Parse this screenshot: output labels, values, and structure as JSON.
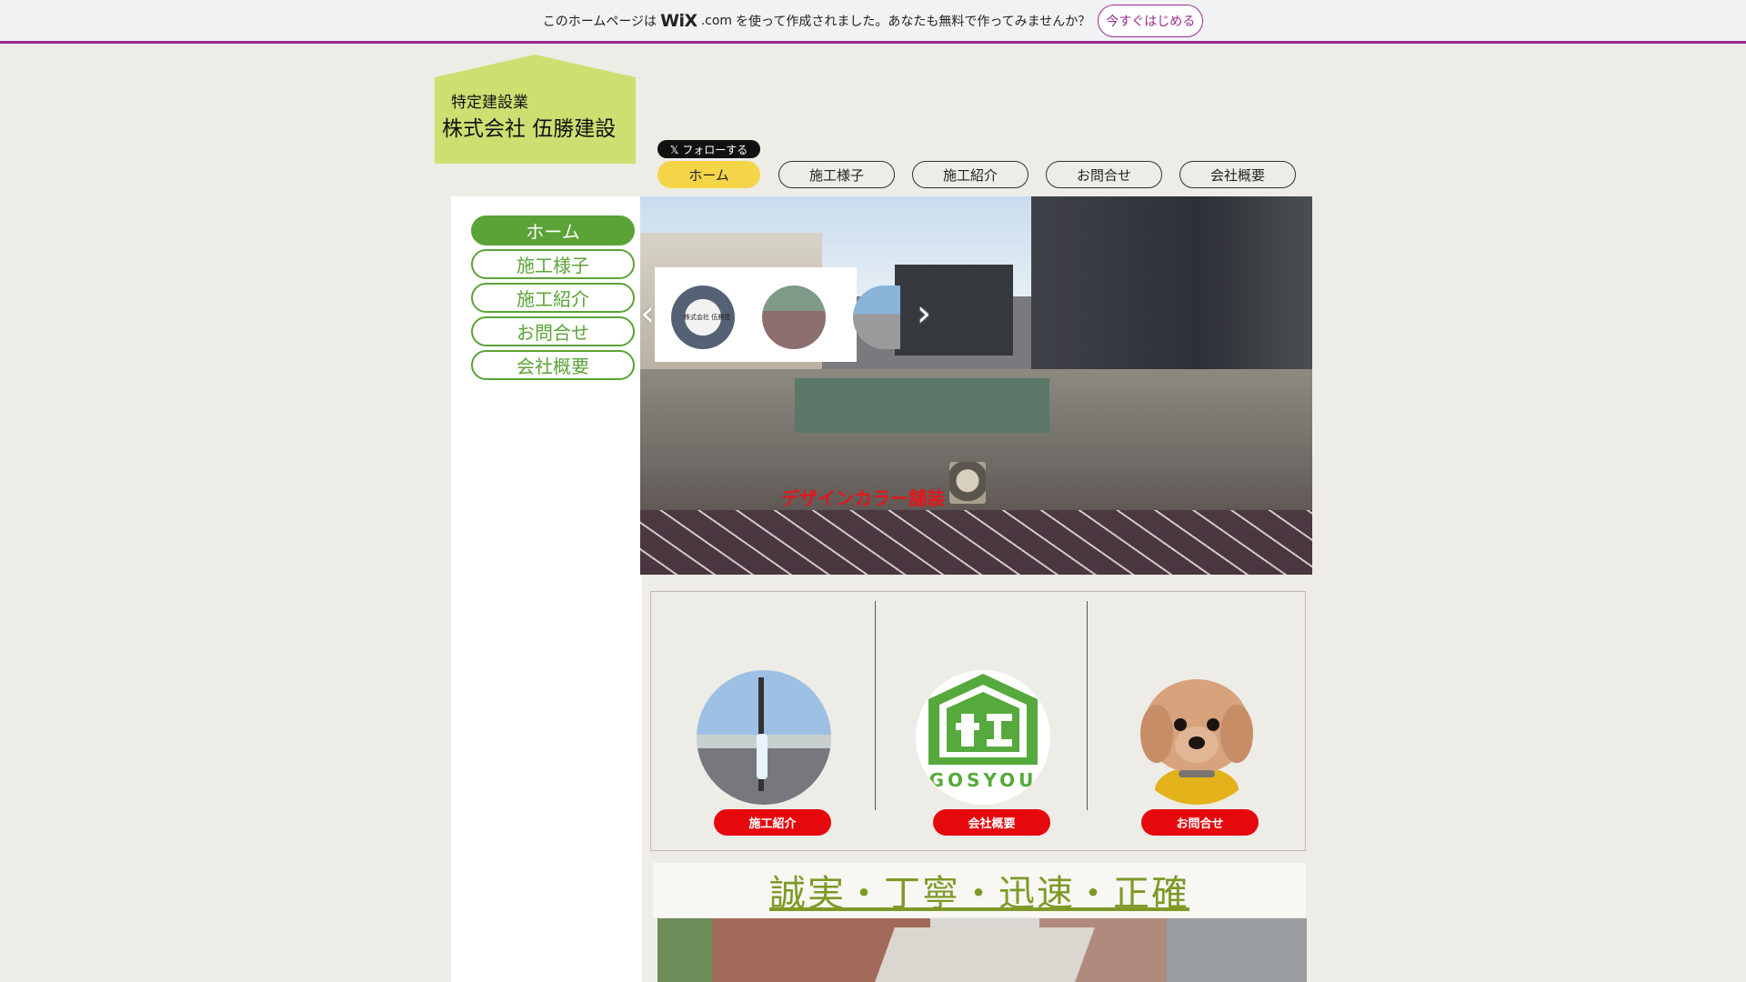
{
  "wix_banner": {
    "prefix": "このホームページは",
    "logo": "WiX",
    "logo_suffix": ".com",
    "suffix": "を使って作成されました。あなたも無料で作ってみませんか？",
    "button": "今すぐはじめる",
    "accent": "#9a2a8e"
  },
  "logo": {
    "small": "特定建設業",
    "big": "株式会社 伍勝建設",
    "bg_color": "#cce071"
  },
  "x_follow": "𝕏 フォローする",
  "top_nav": [
    {
      "label": "ホーム",
      "active": true
    },
    {
      "label": "施工様子",
      "active": false
    },
    {
      "label": "施工紹介",
      "active": false
    },
    {
      "label": "お問合せ",
      "active": false
    },
    {
      "label": "会社概要",
      "active": false
    }
  ],
  "side_nav": [
    {
      "label": "ホーム",
      "active": true
    },
    {
      "label": "施工様子",
      "active": false
    },
    {
      "label": "施工紹介",
      "active": false
    },
    {
      "label": "お問合せ",
      "active": false
    },
    {
      "label": "会社概要",
      "active": false
    }
  ],
  "hero": {
    "caption": "デザインカラー舗装",
    "thumb_label": "株式会社 伍勝建"
  },
  "features": [
    {
      "button": "施工紹介"
    },
    {
      "button": "会社概要"
    },
    {
      "button": "お問合せ"
    }
  ],
  "badge_text": "GOSYOU",
  "slogan": "誠実・丁寧・迅速・正確",
  "colors": {
    "nav_active": "#f5d548",
    "side_green": "#5ba337",
    "red": "#e5090e",
    "slogan": "#7d9a27"
  }
}
